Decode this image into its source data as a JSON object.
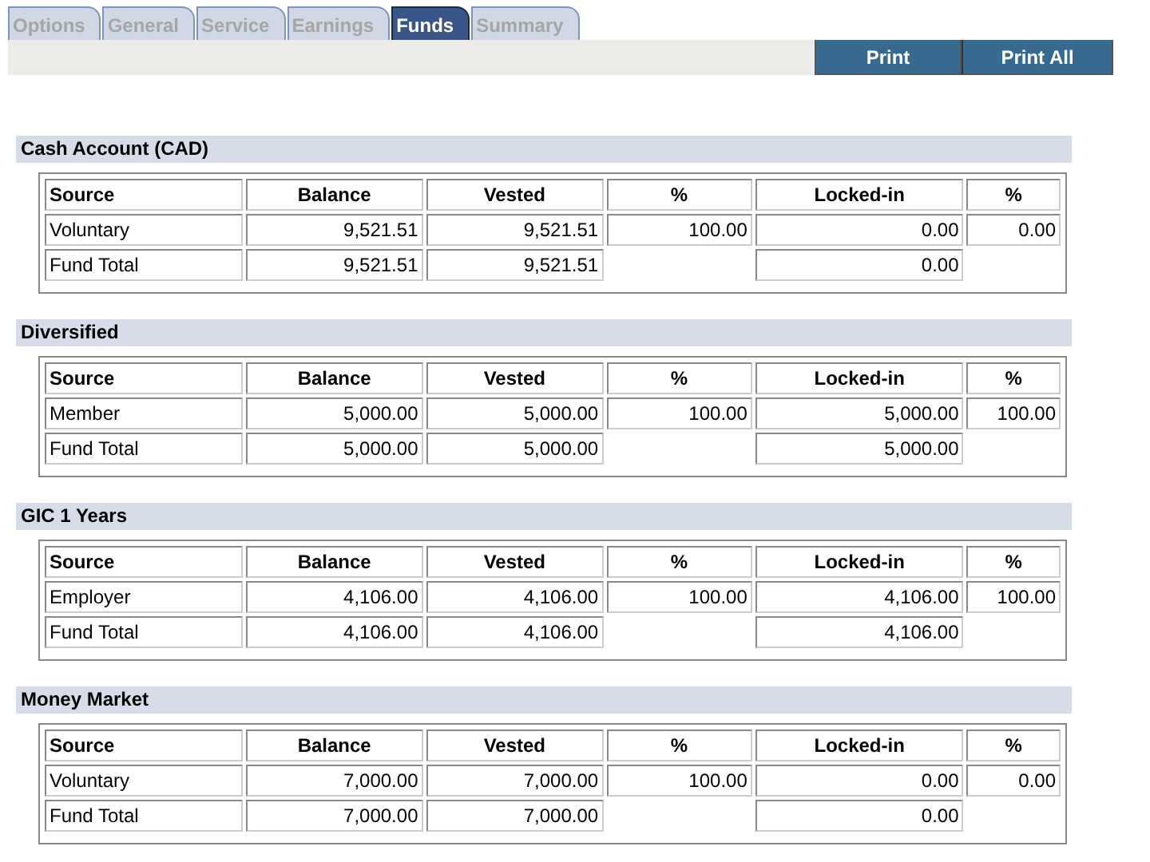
{
  "tabs": [
    {
      "label": "Options",
      "selected": false
    },
    {
      "label": "General",
      "selected": false
    },
    {
      "label": "Service",
      "selected": false
    },
    {
      "label": "Earnings",
      "selected": false
    },
    {
      "label": "Funds",
      "selected": true
    },
    {
      "label": "Summary",
      "selected": false
    }
  ],
  "toolbar": {
    "buttons": [
      "Print",
      "Print All"
    ]
  },
  "funds": [
    {
      "title": "Cash Account (CAD)",
      "columns": [
        "Source",
        "Balance",
        "Vested",
        "%",
        "Locked-in",
        "%"
      ],
      "rows": [
        {
          "source": "Voluntary",
          "balance": "9,521.51",
          "vested": "9,521.51",
          "vested_pct": "100.00",
          "locked_in": "0.00",
          "locked_pct": "0.00"
        },
        {
          "source": "Fund Total",
          "balance": "9,521.51",
          "vested": "9,521.51",
          "locked_in": "0.00"
        }
      ]
    },
    {
      "title": "Diversified",
      "columns": [
        "Source",
        "Balance",
        "Vested",
        "%",
        "Locked-in",
        "%"
      ],
      "rows": [
        {
          "source": "Member",
          "balance": "5,000.00",
          "vested": "5,000.00",
          "vested_pct": "100.00",
          "locked_in": "5,000.00",
          "locked_pct": "100.00"
        },
        {
          "source": "Fund Total",
          "balance": "5,000.00",
          "vested": "5,000.00",
          "locked_in": "5,000.00"
        }
      ]
    },
    {
      "title": "GIC 1 Years",
      "columns": [
        "Source",
        "Balance",
        "Vested",
        "%",
        "Locked-in",
        "%"
      ],
      "rows": [
        {
          "source": "Employer",
          "balance": "4,106.00",
          "vested": "4,106.00",
          "vested_pct": "100.00",
          "locked_in": "4,106.00",
          "locked_pct": "100.00"
        },
        {
          "source": "Fund Total",
          "balance": "4,106.00",
          "vested": "4,106.00",
          "locked_in": "4,106.00"
        }
      ]
    },
    {
      "title": "Money Market",
      "columns": [
        "Source",
        "Balance",
        "Vested",
        "%",
        "Locked-in",
        "%"
      ],
      "rows": [
        {
          "source": "Voluntary",
          "balance": "7,000.00",
          "vested": "7,000.00",
          "vested_pct": "100.00",
          "locked_in": "0.00",
          "locked_pct": "0.00"
        },
        {
          "source": "Fund Total",
          "balance": "7,000.00",
          "vested": "7,000.00",
          "locked_in": "0.00"
        }
      ]
    }
  ]
}
